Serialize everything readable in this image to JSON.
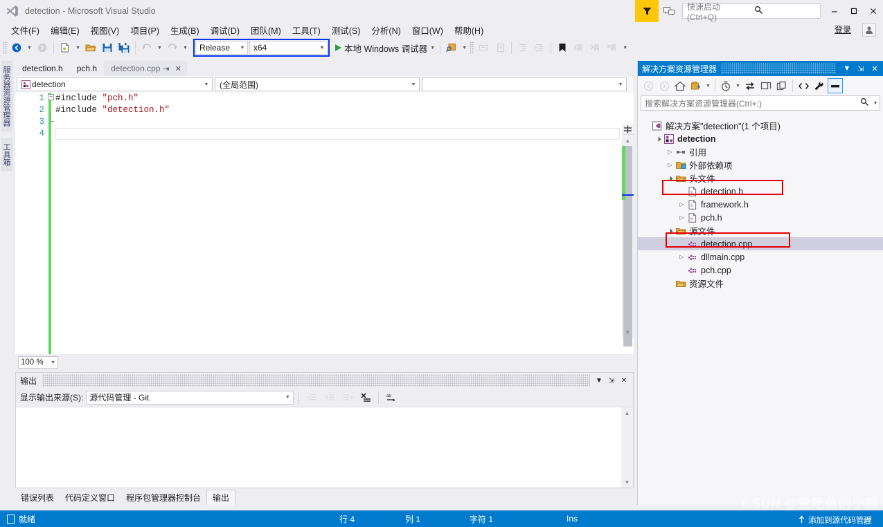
{
  "window": {
    "title": "detection - Microsoft Visual Studio",
    "logo_icon": "visual-studio-logo",
    "minimize_label": "–",
    "maximize_label": "❐",
    "close_label": "✕",
    "filter_icon": "funnel-icon",
    "feedback_icon": "feedback-icon",
    "account_icon": "account-icon"
  },
  "quick_launch": {
    "placeholder": "快速启动 (Ctrl+Q)",
    "value": "",
    "search_icon": "search-icon"
  },
  "signin": {
    "label": "登录"
  },
  "menu": {
    "items": [
      {
        "label": "文件(F)"
      },
      {
        "label": "编辑(E)"
      },
      {
        "label": "视图(V)"
      },
      {
        "label": "项目(P)"
      },
      {
        "label": "生成(B)"
      },
      {
        "label": "调试(D)"
      },
      {
        "label": "团队(M)"
      },
      {
        "label": "工具(T)"
      },
      {
        "label": "测试(S)"
      },
      {
        "label": "分析(N)"
      },
      {
        "label": "窗口(W)"
      },
      {
        "label": "帮助(H)"
      }
    ]
  },
  "toolbar": {
    "navigate_back_icon": "navigate-back-icon",
    "navigate_forward_icon": "navigate-forward-icon",
    "new_project_icon": "new-project-icon",
    "open_file_icon": "open-file-icon",
    "save_icon": "save-icon",
    "save_all_icon": "save-all-icon",
    "undo_icon": "undo-icon",
    "redo_icon": "redo-icon",
    "configuration": {
      "value": "Release",
      "name": "solution-configuration"
    },
    "platform": {
      "value": "x64",
      "name": "solution-platform"
    },
    "debug_target": {
      "label": "本地 Windows 调试器",
      "play_icon": "play-icon"
    },
    "find_icon": "find-in-files-icon",
    "comment_icon": "comment-icon",
    "uncomment_icon": "uncomment-icon",
    "decrease_indent_icon": "decrease-indent-icon",
    "increase_indent_icon": "increase-indent-icon",
    "bookmark_icon": "bookmark-icon",
    "prev_bookmark_icon": "previous-bookmark-icon",
    "next_bookmark_icon": "next-bookmark-icon",
    "clear_bookmarks_icon": "clear-bookmarks-icon",
    "highlight_color": "#0632f2"
  },
  "left_strip": {
    "tabs": [
      {
        "label": "服务器资源管理器"
      },
      {
        "label": "工具箱"
      }
    ]
  },
  "editor": {
    "tabs": [
      {
        "label": "detection.h",
        "active": false
      },
      {
        "label": "pch.h",
        "active": false
      },
      {
        "label": "detection.cpp",
        "active": true,
        "pin_icon": "pin-icon",
        "close_icon": "close-icon"
      }
    ],
    "nav": {
      "project": {
        "value": "detection",
        "icon": "project-icon"
      },
      "scope": {
        "value": "(全局范围)"
      },
      "member": {
        "value": ""
      }
    },
    "line_numbers": [
      "1",
      "2",
      "3",
      "4"
    ],
    "lines": [
      {
        "directive": "#include",
        "space": " ",
        "string": "\"pch.h\""
      },
      {
        "directive": "#include",
        "space": " ",
        "string": "\"detection.h\""
      },
      {
        "directive": "",
        "space": "",
        "string": ""
      },
      {
        "directive": "",
        "space": "",
        "string": ""
      }
    ],
    "collapse_glyph": "−",
    "zoom": {
      "value": "100 %"
    },
    "scroll_up_icon": "scroll-up-icon",
    "scroll_down_icon": "scroll-down-icon",
    "split_icon": "split-view-icon"
  },
  "output": {
    "title": "输出",
    "source_label": "显示输出来源(S):",
    "source_value": "源代码管理 - Git",
    "body_text": "",
    "dropdown_icon": "chevron-down-icon",
    "pin_icon": "pin-icon",
    "close_icon": "close-icon",
    "tool_icons": [
      "find-message-icon",
      "go-to-previous-icon",
      "go-to-next-icon",
      "clear-all-icon",
      "toggle-word-wrap-icon"
    ]
  },
  "bottom_tabs": [
    {
      "label": "错误列表",
      "active": false
    },
    {
      "label": "代码定义窗口",
      "active": false
    },
    {
      "label": "程序包管理器控制台",
      "active": false
    },
    {
      "label": "输出",
      "active": true
    }
  ],
  "solution_explorer": {
    "title": "解决方案资源管理器",
    "dropdown_icon": "chevron-down-icon",
    "pin_icon": "pin-icon",
    "close_icon": "close-icon",
    "search_placeholder": "搜索解决方案资源管理器(Ctrl+;)",
    "search_icon": "search-icon",
    "toolbar_icons": [
      "back-icon",
      "forward-icon",
      "home-icon",
      "add-new-item-icon",
      "pending-changes-icon",
      "sync-icon",
      "collapse-all-icon",
      "refresh-icon",
      "show-all-files-icon",
      "properties-icon",
      "preview-selected-items-icon"
    ],
    "tree": [
      {
        "depth": 0,
        "twisty": "",
        "icon": "solution-icon",
        "label": "解决方案\"detection\"(1 个项目)",
        "bold": false,
        "selected": false
      },
      {
        "depth": 1,
        "twisty": "open",
        "icon": "cpp-project-icon",
        "label": "detection",
        "bold": true,
        "selected": false
      },
      {
        "depth": 2,
        "twisty": "closed",
        "icon": "references-icon",
        "label": "引用",
        "bold": false,
        "selected": false
      },
      {
        "depth": 2,
        "twisty": "closed",
        "icon": "external-dependencies-icon",
        "label": "外部依赖项",
        "bold": false,
        "selected": false
      },
      {
        "depth": 2,
        "twisty": "open",
        "icon": "filter-folder-icon",
        "label": "头文件",
        "bold": false,
        "selected": false
      },
      {
        "depth": 3,
        "twisty": "",
        "icon": "header-file-icon",
        "label": "detection.h",
        "bold": false,
        "selected": false,
        "highlight": true
      },
      {
        "depth": 3,
        "twisty": "closed",
        "icon": "header-file-icon",
        "label": "framework.h",
        "bold": false,
        "selected": false
      },
      {
        "depth": 3,
        "twisty": "closed",
        "icon": "header-file-icon",
        "label": "pch.h",
        "bold": false,
        "selected": false
      },
      {
        "depth": 2,
        "twisty": "open",
        "icon": "filter-folder-icon",
        "label": "源文件",
        "bold": false,
        "selected": false
      },
      {
        "depth": 3,
        "twisty": "",
        "icon": "cpp-file-icon",
        "label": "detection.cpp",
        "bold": false,
        "selected": true,
        "highlight": true
      },
      {
        "depth": 3,
        "twisty": "closed",
        "icon": "cpp-file-icon",
        "label": "dllmain.cpp",
        "bold": false,
        "selected": false
      },
      {
        "depth": 3,
        "twisty": "",
        "icon": "cpp-file-icon",
        "label": "pch.cpp",
        "bold": false,
        "selected": false
      },
      {
        "depth": 2,
        "twisty": "",
        "icon": "filter-folder-icon",
        "label": "资源文件",
        "bold": false,
        "selected": false
      }
    ],
    "highlight_color": "#e10000",
    "selection_color": "#cfcfe0"
  },
  "statusbar": {
    "ready": "就绪",
    "ready_icon": "ready-flag-icon",
    "line_label": "行 4",
    "col_label": "列 1",
    "char_label": "字符 1",
    "insert_mode": "Ins",
    "source_control": "添加到源代码管理",
    "source_control_icon": "add-to-source-control-icon",
    "background": "#007acc"
  },
  "watermark": {
    "text": "CSDN @爱吃鱼的小熊"
  }
}
